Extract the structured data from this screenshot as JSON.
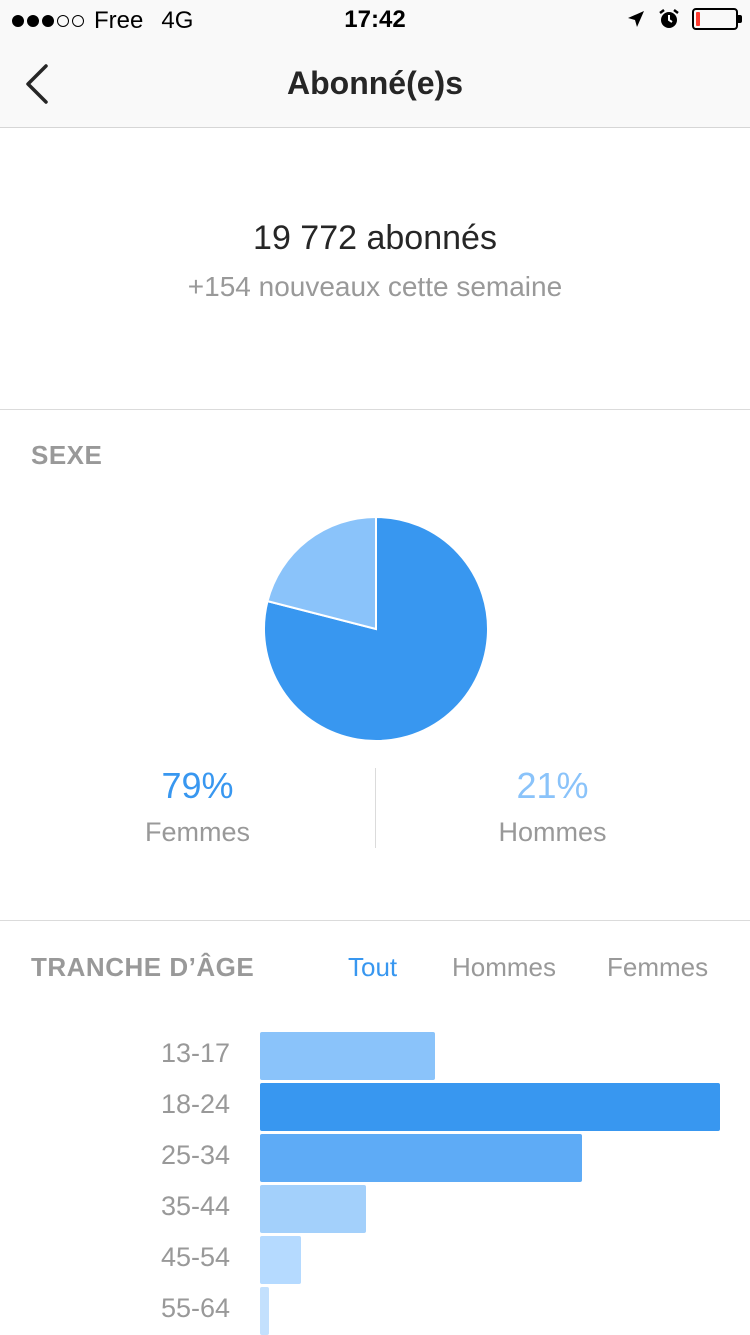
{
  "status_bar": {
    "signal": [
      true,
      true,
      true,
      false,
      false
    ],
    "carrier": "Free",
    "network": "4G",
    "time": "17:42",
    "battery_level": 0.1,
    "battery_color": "#ff3b30"
  },
  "nav": {
    "title": "Abonné(e)s"
  },
  "summary": {
    "total": "19 772 abonnés",
    "weekly": "+154 nouveaux cette semaine"
  },
  "gender": {
    "title": "SEXE",
    "women_pct": "79%",
    "women_label": "Femmes",
    "men_pct": "21%",
    "men_label": "Hommes"
  },
  "age": {
    "title": "TRANCHE D’ÂGE",
    "tabs": [
      {
        "label": "Tout",
        "active": true
      },
      {
        "label": "Hommes",
        "active": false
      },
      {
        "label": "Femmes",
        "active": false
      }
    ]
  },
  "colors": {
    "accent": "#3897f0",
    "light_blue": "#8ac3fa"
  },
  "chart_data": [
    {
      "type": "pie",
      "labels": [
        "Femmes",
        "Hommes"
      ],
      "values": [
        79,
        21
      ],
      "colors": [
        "#3897f0",
        "#8ac3fa"
      ]
    },
    {
      "type": "bar",
      "orientation": "horizontal",
      "categories": [
        "13-17",
        "18-24",
        "25-34",
        "35-44",
        "45-54",
        "55-64"
      ],
      "values": [
        38,
        100,
        70,
        23,
        9,
        2
      ],
      "colors": [
        "#8ac3fa",
        "#3897f0",
        "#5eabf6",
        "#a3d0fb",
        "#b5daff",
        "#c3e0fd"
      ]
    }
  ]
}
